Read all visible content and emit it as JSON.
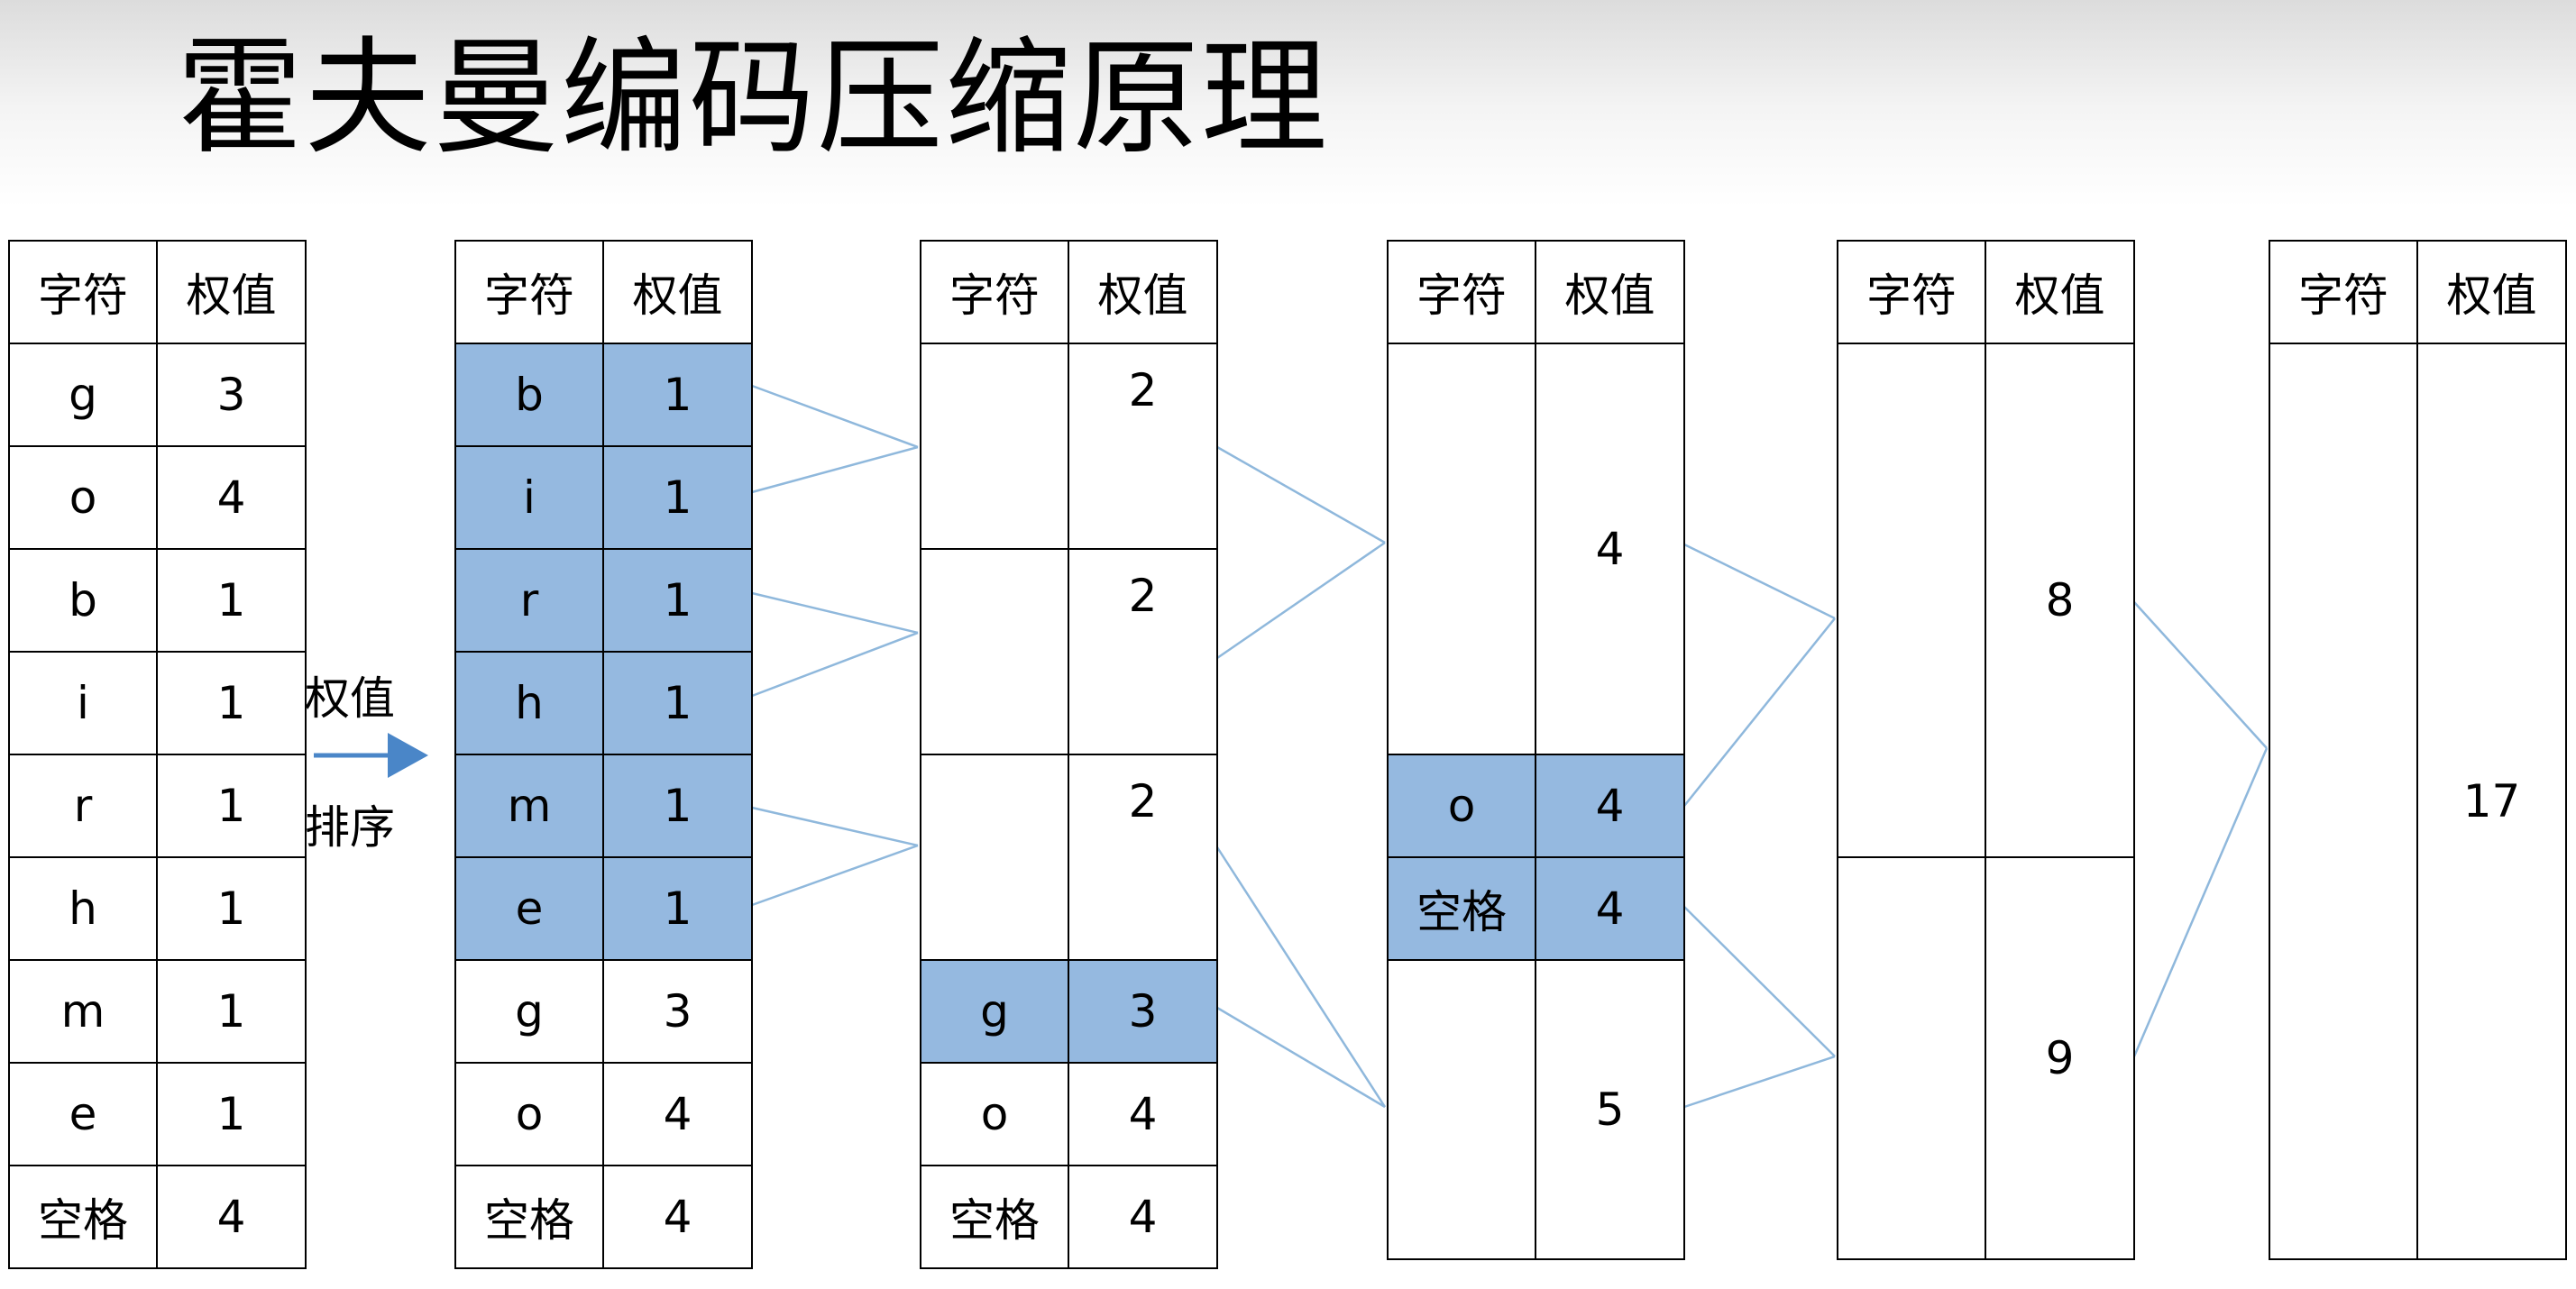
{
  "title": "霍夫曼编码压缩原理",
  "header": {
    "char": "字符",
    "weight": "权值"
  },
  "arrow_label_top": "权值",
  "arrow_label_bottom": "排序",
  "colors": {
    "highlight": "#95b9e0",
    "link": "#8fb8dc",
    "arrow": "#4a86c8"
  },
  "tables": [
    {
      "rows": [
        {
          "char": "g",
          "weight": "3",
          "hl": false
        },
        {
          "char": "o",
          "weight": "4",
          "hl": false
        },
        {
          "char": "b",
          "weight": "1",
          "hl": false
        },
        {
          "char": "i",
          "weight": "1",
          "hl": false
        },
        {
          "char": "r",
          "weight": "1",
          "hl": false
        },
        {
          "char": "h",
          "weight": "1",
          "hl": false
        },
        {
          "char": "m",
          "weight": "1",
          "hl": false
        },
        {
          "char": "e",
          "weight": "1",
          "hl": false
        },
        {
          "char": "空格",
          "weight": "4",
          "hl": false
        }
      ]
    },
    {
      "rows": [
        {
          "char": "b",
          "weight": "1",
          "hl": true
        },
        {
          "char": "i",
          "weight": "1",
          "hl": true
        },
        {
          "char": "r",
          "weight": "1",
          "hl": true
        },
        {
          "char": "h",
          "weight": "1",
          "hl": true
        },
        {
          "char": "m",
          "weight": "1",
          "hl": true
        },
        {
          "char": "e",
          "weight": "1",
          "hl": true
        },
        {
          "char": "g",
          "weight": "3",
          "hl": false
        },
        {
          "char": "o",
          "weight": "4",
          "hl": false
        },
        {
          "char": "空格",
          "weight": "4",
          "hl": false
        }
      ]
    },
    {
      "rows": [
        {
          "char": "",
          "weight": "2",
          "hl": false
        },
        {
          "char": "",
          "weight": "2",
          "hl": false
        },
        {
          "char": "",
          "weight": "2",
          "hl": false
        },
        {
          "char": "g",
          "weight": "3",
          "hl": true
        },
        {
          "char": "o",
          "weight": "4",
          "hl": false
        },
        {
          "char": "空格",
          "weight": "4",
          "hl": false
        }
      ]
    },
    {
      "rows": [
        {
          "char": "",
          "weight": "4",
          "hl": false
        },
        {
          "char": "o",
          "weight": "4",
          "hl": true
        },
        {
          "char": "空格",
          "weight": "4",
          "hl": true
        },
        {
          "char": "",
          "weight": "5",
          "hl": false
        }
      ]
    },
    {
      "rows": [
        {
          "char": "",
          "weight": "8",
          "hl": false
        },
        {
          "char": "",
          "weight": "9",
          "hl": false
        }
      ]
    },
    {
      "rows": [
        {
          "char": "",
          "weight": "17",
          "hl": false
        }
      ]
    }
  ]
}
